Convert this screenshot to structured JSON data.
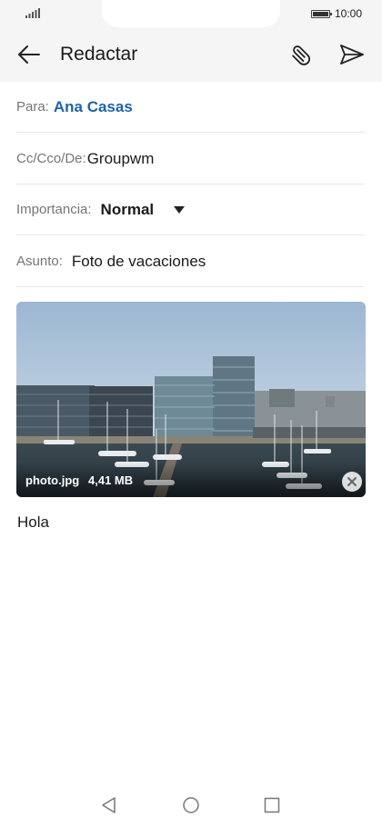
{
  "status_bar": {
    "time": "10:00",
    "icons": [
      "signal-icon",
      "battery-icon"
    ]
  },
  "app_bar": {
    "title": "Redactar",
    "icons": [
      "back-arrow-icon",
      "paperclip-icon",
      "send-icon"
    ]
  },
  "compose": {
    "to_label": "Para:",
    "to_value": "Ana Casas",
    "cc_label": "Cc/Cco/De:",
    "cc_value": "Groupwm",
    "importance_label": "Importancia:",
    "importance_value": "Normal",
    "subject_label": "Asunto:",
    "subject_value": "Foto de vacaciones"
  },
  "attachment": {
    "file_name": "photo.jpg",
    "file_size": "4,41 MB",
    "icons": [
      "close-icon"
    ]
  },
  "body": {
    "text": "Hola"
  },
  "colors": {
    "link_blue": "#1f63a8",
    "header_bg": "#f5f5f5",
    "divider": "#e6e6e6"
  },
  "nav_bar": {
    "icons": [
      "nav-back-icon",
      "nav-home-icon",
      "nav-recent-apps-icon"
    ]
  }
}
